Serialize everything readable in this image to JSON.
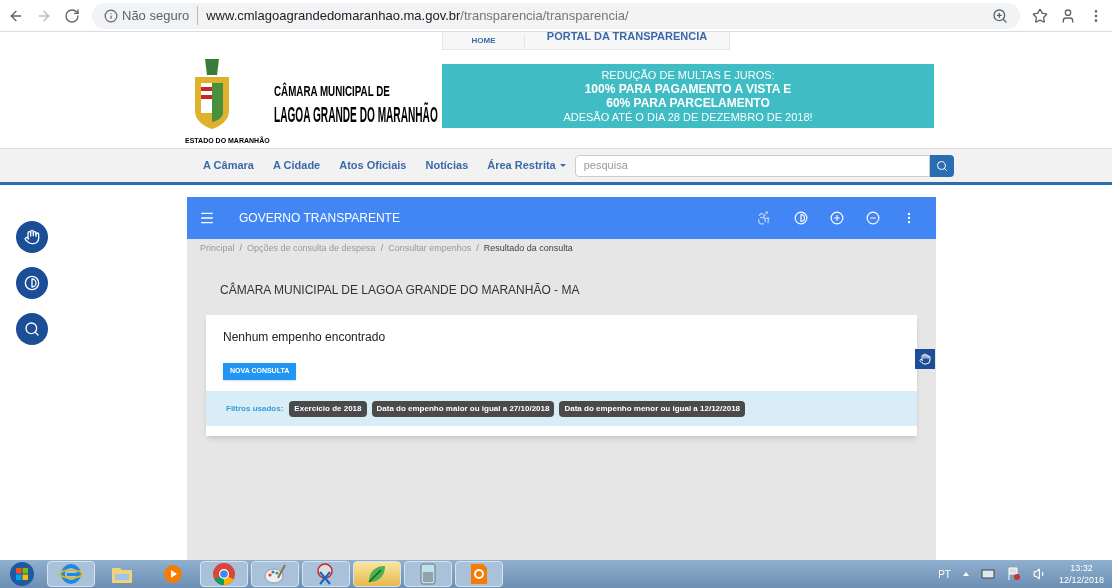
{
  "browser": {
    "security_label": "Não seguro",
    "url_host": "www.cmlagoagrandedomaranhao.ma.gov.br",
    "url_path": "/transparencia/transparencia/"
  },
  "header": {
    "top_links": [
      "HOME",
      "PORTAL DA TRANSPARENCIA"
    ],
    "logo": {
      "line1": "CÂMARA MUNICIPAL DE",
      "line2": "LAGOA GRANDE DO MARANHÃO",
      "state": "ESTADO DO MARANHÃO"
    },
    "banner": {
      "line1": "REDUÇÃO DE MULTAS E JUROS:",
      "line2": "100% PARA PAGAMENTO A VISTA E",
      "line3": "60% PARA PARCELAMENTO",
      "line4": "ADESÃO ATÉ O DIA 28 DE DEZEMBRO DE 2018!"
    }
  },
  "nav": {
    "items": [
      {
        "label": "A Câmara",
        "dropdown": false
      },
      {
        "label": "A Cidade",
        "dropdown": false
      },
      {
        "label": "Atos Oficiais",
        "dropdown": false
      },
      {
        "label": "Notícias",
        "dropdown": false
      },
      {
        "label": "Área Restrita",
        "dropdown": true
      }
    ],
    "search": {
      "placeholder": "pesquisa"
    }
  },
  "panel": {
    "title": "GOVERNO TRANSPARENTE",
    "breadcrumb_separator": "/",
    "breadcrumb": [
      {
        "label": "Principal",
        "current": false
      },
      {
        "label": "Opções de consulta de despesa",
        "current": false
      },
      {
        "label": "Consultar empenhos",
        "current": false
      },
      {
        "label": "Resultado da consulta",
        "current": true
      }
    ],
    "heading": "CÂMARA MUNICIPAL DE LAGOA GRANDE DO MARANHÃO - MA",
    "card": {
      "message": "Nenhum empenho encontrado",
      "button": "NOVA CONSULTA",
      "filters_label": "Filtros usados:",
      "filters": [
        "Exercício de 2018",
        "Data do empenho maior ou igual a 27/10/2018",
        "Data do empenho menor ou igual a 12/12/2018"
      ]
    }
  },
  "taskbar": {
    "apps": [
      {
        "kind": "ie",
        "running": true,
        "active": false
      },
      {
        "kind": "folder",
        "running": false,
        "active": false
      },
      {
        "kind": "media",
        "running": false,
        "active": false
      },
      {
        "kind": "chrome",
        "running": true,
        "active": false
      },
      {
        "kind": "paint",
        "running": true,
        "active": false
      },
      {
        "kind": "snip",
        "running": true,
        "active": false
      },
      {
        "kind": "green",
        "running": true,
        "active": true
      },
      {
        "kind": "calc",
        "running": true,
        "active": false
      },
      {
        "kind": "foxit",
        "running": true,
        "active": false
      }
    ],
    "tray": {
      "language": "PT",
      "time": "13:32",
      "date": "12/12/2018"
    }
  }
}
